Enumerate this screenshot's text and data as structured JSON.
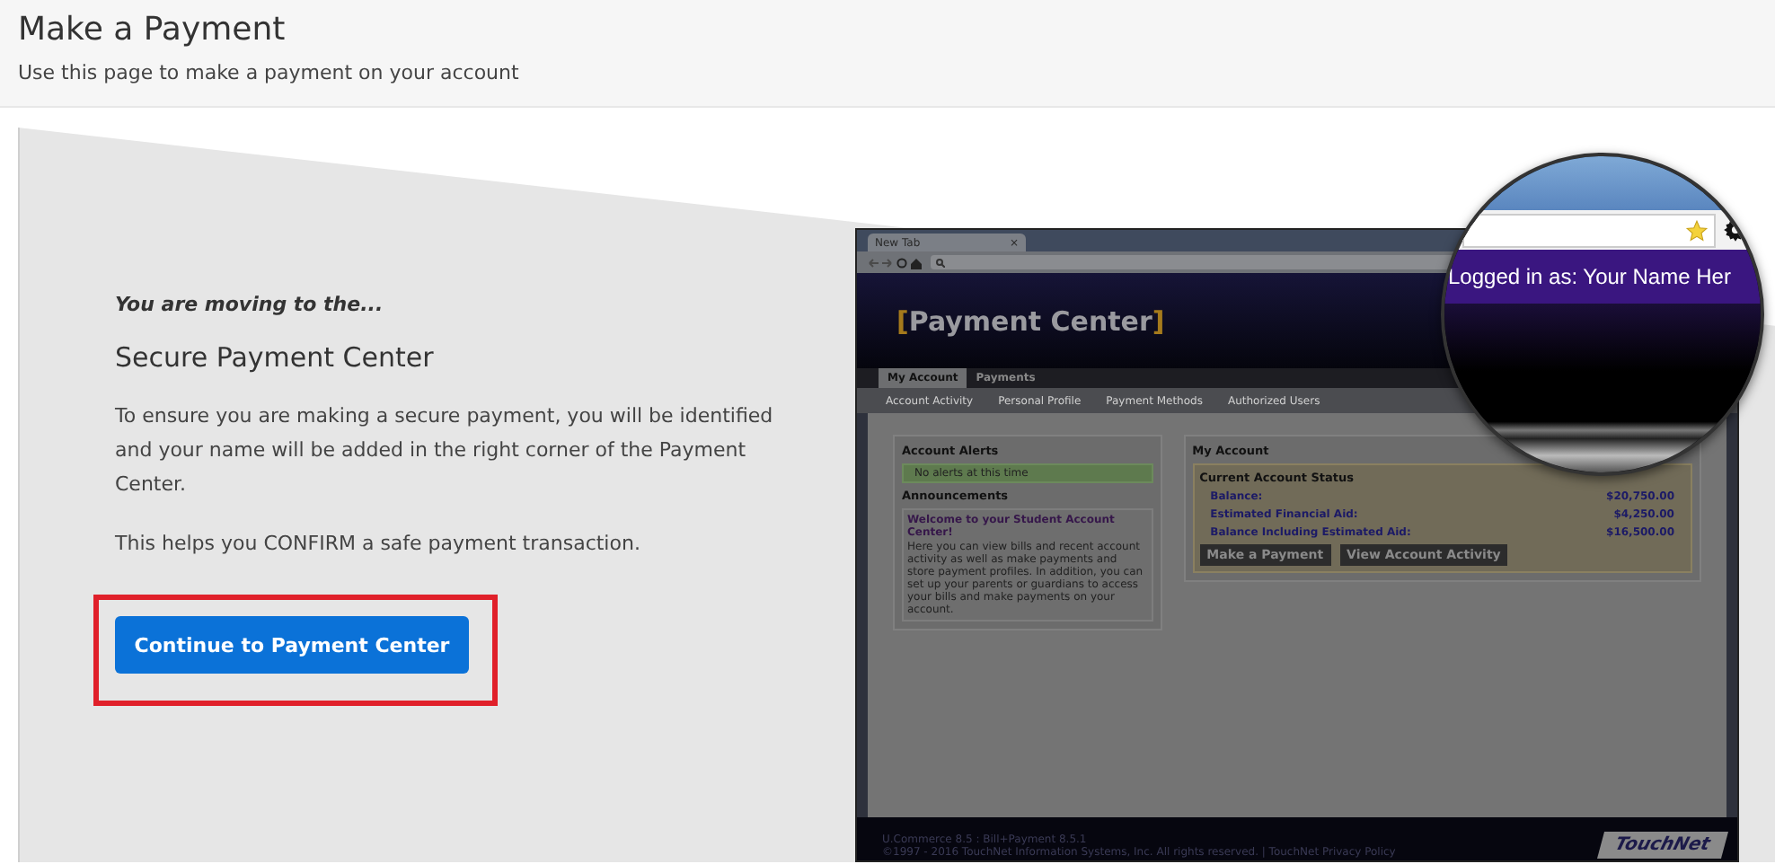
{
  "header": {
    "title": "Make a Payment",
    "subtitle": "Use this page to make a payment on your account"
  },
  "intro": {
    "kicker": "You are moving to the...",
    "heading": "Secure Payment Center",
    "paragraphs": [
      "To ensure you are making a secure payment, you will be identified and your name will be added in the right corner of the Payment Center.",
      "This helps you CONFIRM a safe payment transaction."
    ],
    "button": "Continue to Payment Center",
    "highlighted": true
  },
  "screenshot": {
    "browser_tab": "New Tab",
    "tab_close": "×",
    "brackets": [
      "[",
      "]"
    ],
    "app_title": "Payment Center",
    "tabs": [
      {
        "label": "My Account",
        "selected": true
      },
      {
        "label": "Payments",
        "selected": false
      }
    ],
    "subnav": [
      "Account Activity",
      "Personal Profile",
      "Payment Methods",
      "Authorized Users"
    ],
    "alerts": {
      "title": "Account Alerts",
      "message": "No alerts at this time"
    },
    "announcements": {
      "title": "Announcements",
      "headline": "Welcome to your Student Account Center!",
      "body": "Here you can view bills and recent account activity as well as make payments and store payment profiles. In addition, you can set up your parents or guardians to access your bills and make payments on your account."
    },
    "account": {
      "title": "My Account",
      "status_title": "Current Account Status",
      "rows": [
        {
          "label": "Balance:",
          "value": "$20,750.00"
        },
        {
          "label": "Estimated Financial Aid:",
          "value": "$4,250.00"
        },
        {
          "label": "Balance Including Estimated Aid:",
          "value": "$16,500.00"
        }
      ],
      "buttons": [
        "Make a Payment",
        "View Account Activity"
      ]
    },
    "footer": [
      "U.Commerce 8.5 : Bill+Payment 8.5.1",
      "©1997 - 2016 TouchNet Information Systems, Inc. All rights reserved. | TouchNet Privacy Policy"
    ],
    "logo": "TouchNet",
    "magnifier": {
      "logged_in": "Logged in as: Your Name Her"
    }
  }
}
